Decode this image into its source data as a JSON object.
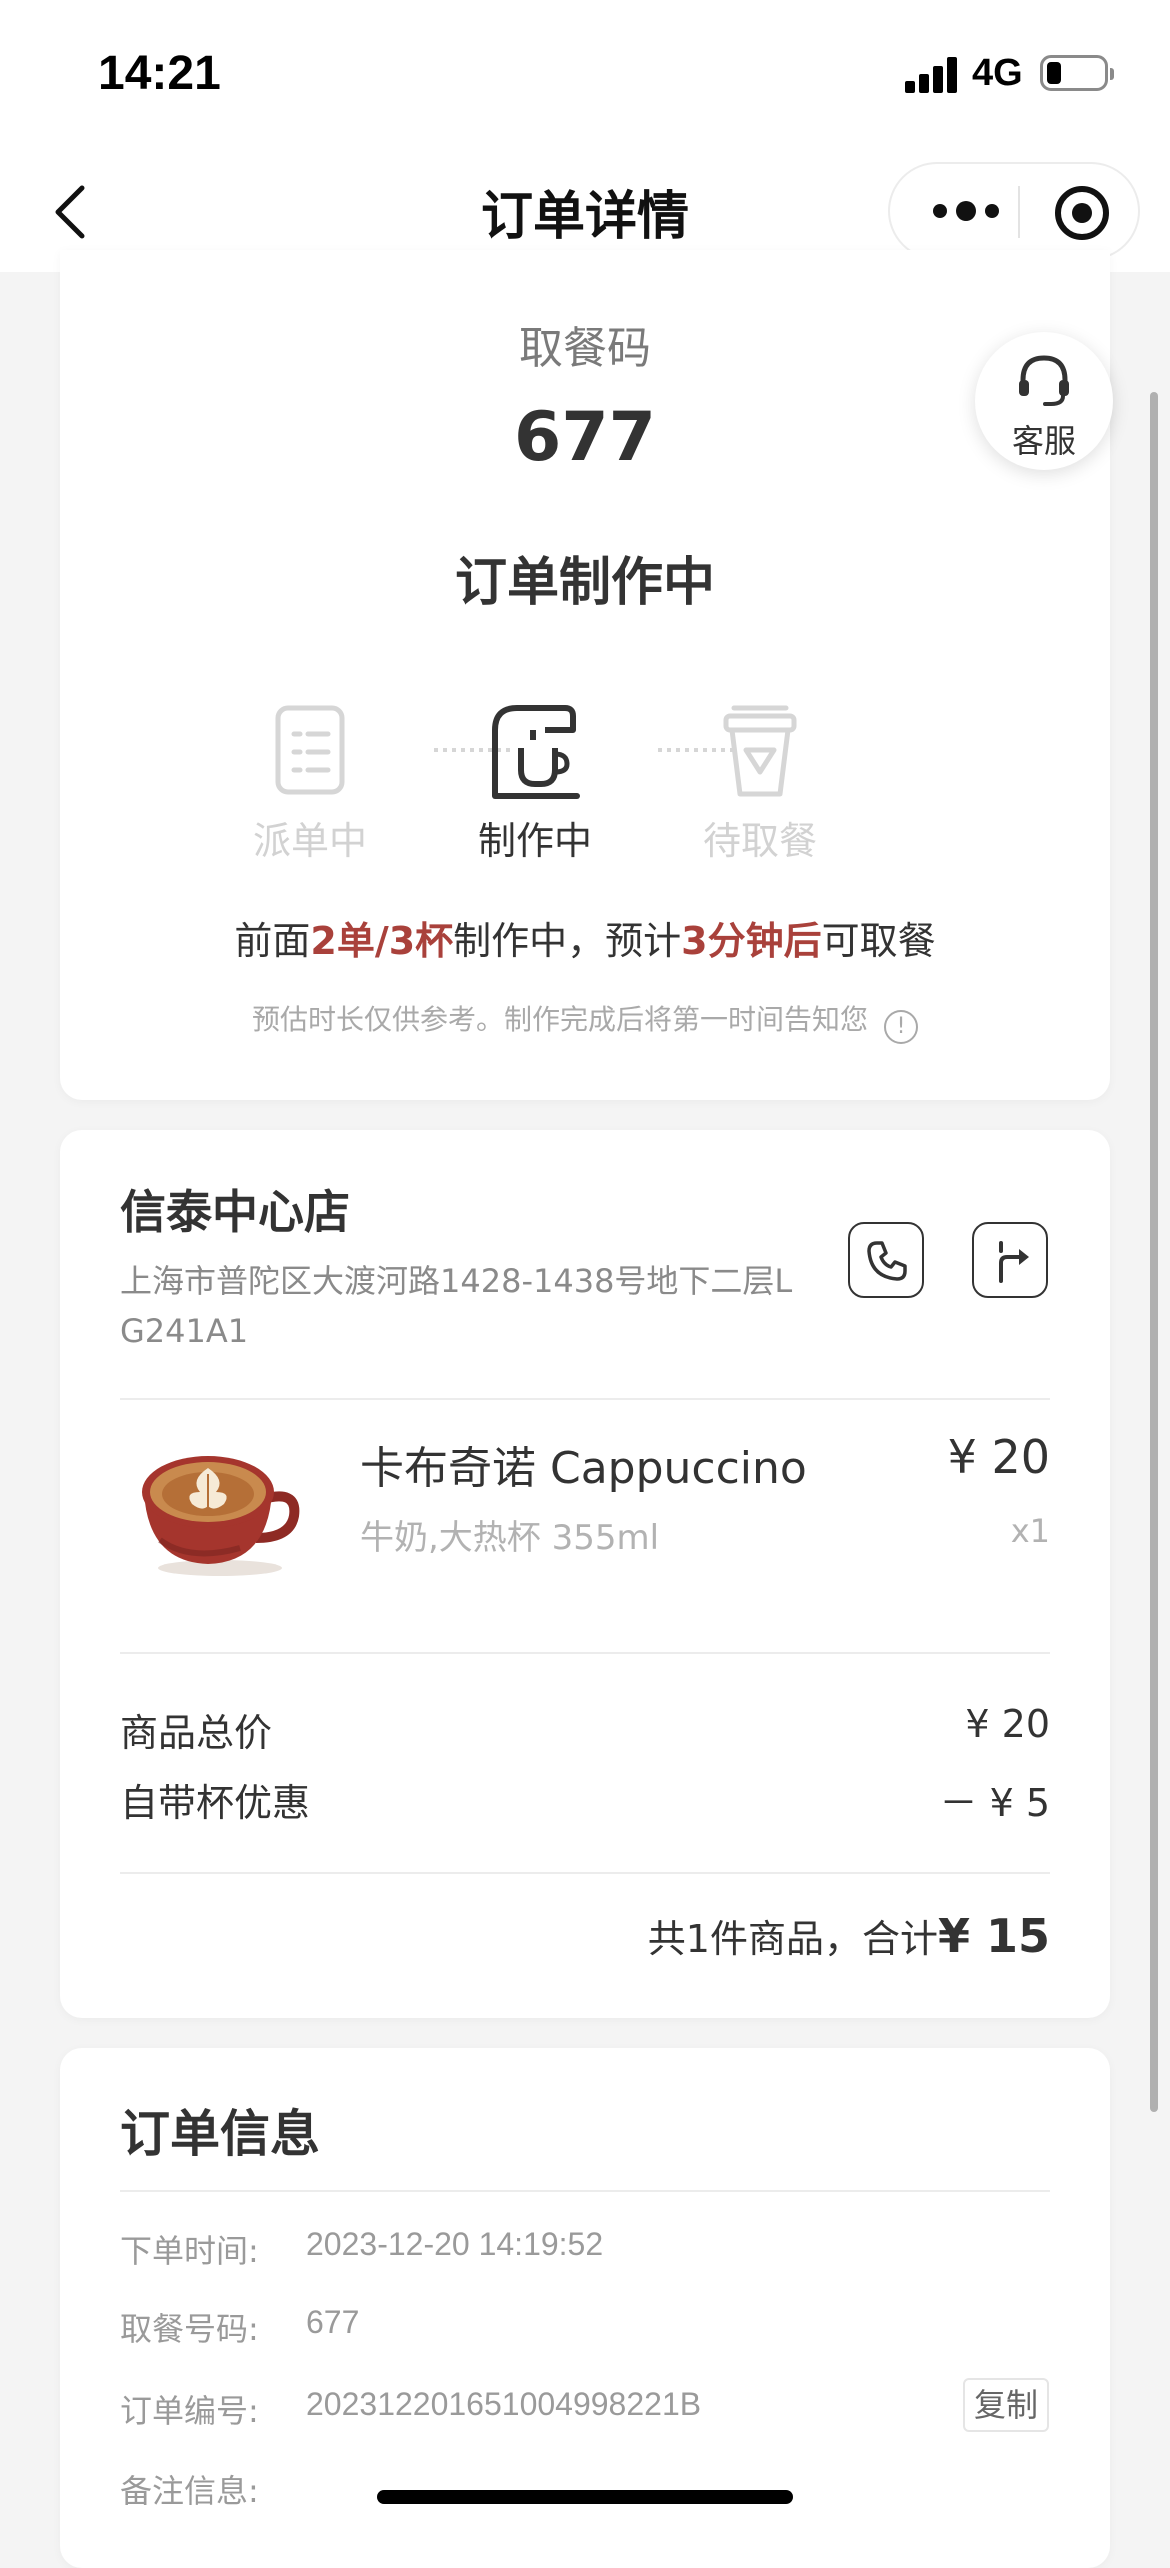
{
  "status_bar": {
    "time": "14:21",
    "network": "4G",
    "battery_level": 0.25
  },
  "nav": {
    "title": "订单详情",
    "icons": [
      "back-chevron-icon",
      "more-dots-icon",
      "close-target-icon"
    ]
  },
  "order_status": {
    "pickup_label": "取餐码",
    "pickup_code": "677",
    "title": "订单制作中",
    "service_label": "客服",
    "steps": [
      {
        "label": "派单中",
        "icon": "dispatch-list-icon",
        "active": false
      },
      {
        "label": "制作中",
        "icon": "coffee-machine-icon",
        "active": true
      },
      {
        "label": "待取餐",
        "icon": "cup-icon",
        "active": false
      }
    ],
    "progress": {
      "prefix": "前面",
      "queue": "2单/3杯",
      "middle": "制作中，预计",
      "eta": "3分钟后",
      "suffix": "可取餐"
    },
    "note": "预估时长仅供参考。制作完成后将第一时间告知您",
    "note_icon": "!"
  },
  "store": {
    "name": "信泰中心店",
    "address": "上海市普陀区大渡河路1428-1438号地下二层L G241A1",
    "icons": [
      "phone-icon",
      "navigation-icon"
    ]
  },
  "product": {
    "name": "卡布奇诺 Cappuccino",
    "spec": "牛奶,大热杯 355ml",
    "price": "¥ 20",
    "qty": "x1"
  },
  "summary": {
    "subtotal_label": "商品总价",
    "subtotal_value": "¥ 20",
    "discount_label": "自带杯优惠",
    "discount_value": "－ ¥ 5",
    "total_prefix": "共1件商品，合计",
    "total_amount": "¥ 15"
  },
  "order_info": {
    "title": "订单信息",
    "rows": [
      {
        "label": "下单时间:",
        "value": "2023-12-20 14:19:52"
      },
      {
        "label": "取餐号码:",
        "value": "677"
      },
      {
        "label": "订单编号:",
        "value": "20231220165100499822​1B"
      },
      {
        "label": "备注信息:",
        "value": ""
      }
    ],
    "copy_label": "复制"
  },
  "colors": {
    "accent": "#a9413b",
    "background": "#f4f4f4",
    "card": "#ffffff"
  }
}
